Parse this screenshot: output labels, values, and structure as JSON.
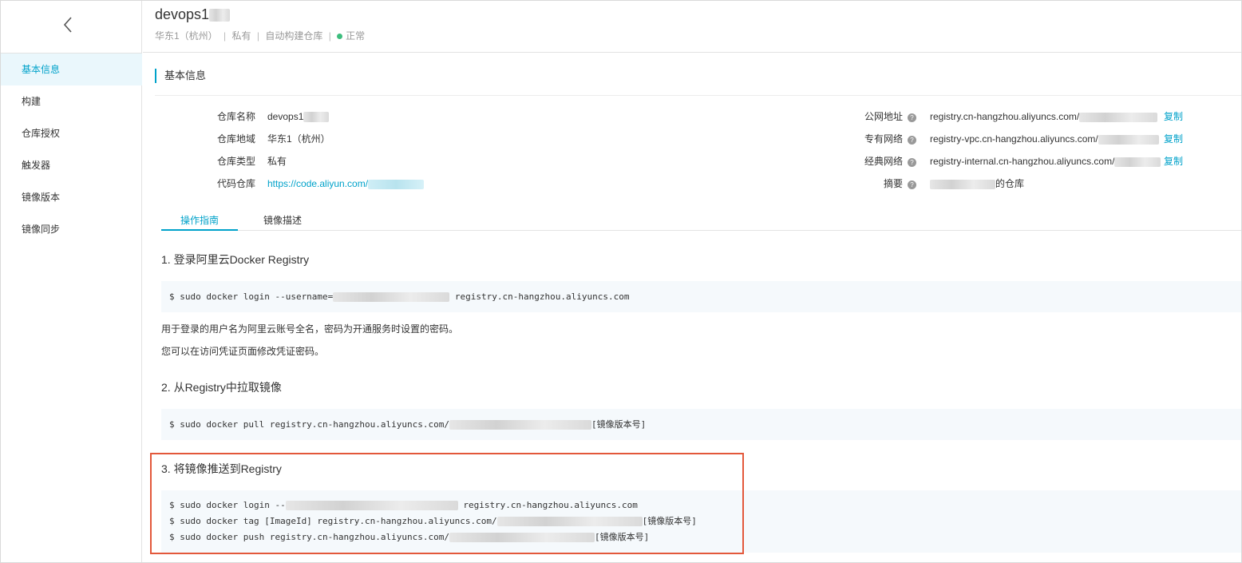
{
  "header": {
    "title": "devops1",
    "region": "华东1（杭州）",
    "type": "私有",
    "source": "自动构建仓库",
    "status": "正常",
    "status_color": "#3dbd7d"
  },
  "sidebar": {
    "items": [
      {
        "label": "基本信息"
      },
      {
        "label": "构建"
      },
      {
        "label": "仓库授权"
      },
      {
        "label": "触发器"
      },
      {
        "label": "镜像版本"
      },
      {
        "label": "镜像同步"
      }
    ]
  },
  "section": {
    "title": "基本信息"
  },
  "info": {
    "name_label": "仓库名称",
    "name_value": "devops1",
    "region_label": "仓库地域",
    "region_value": "华东1（杭州）",
    "type_label": "仓库类型",
    "type_value": "私有",
    "code_label": "代码仓库",
    "code_value": "https://code.aliyun.com/",
    "public_label": "公网地址",
    "public_value": "registry.cn-hangzhou.aliyuncs.com/",
    "vpc_label": "专有网络",
    "vpc_value": "registry-vpc.cn-hangzhou.aliyuncs.com/",
    "classic_label": "经典网络",
    "classic_value": "registry-internal.cn-hangzhou.aliyuncs.com/",
    "summary_label": "摘要",
    "summary_value": "的仓库",
    "copy_label": "复制",
    "help_glyph": "?"
  },
  "tabs": [
    {
      "label": "操作指南"
    },
    {
      "label": "镜像描述"
    }
  ],
  "steps": {
    "s1_title": "1. 登录阿里云Docker Registry",
    "s1_code_a": "$ sudo docker login --username=",
    "s1_code_b": " registry.cn-hangzhou.aliyuncs.com",
    "s1_note1": "用于登录的用户名为阿里云账号全名，密码为开通服务时设置的密码。",
    "s1_note2": "您可以在访问凭证页面修改凭证密码。",
    "s2_title": "2. 从Registry中拉取镜像",
    "s2_code_a": "$ sudo docker pull registry.cn-hangzhou.aliyuncs.com/",
    "s2_code_b": "[镜像版本号]",
    "s3_title": "3. 将镜像推送到Registry",
    "s3_code1_a": "$ sudo docker login --",
    "s3_code1_b": " registry.cn-hangzhou.aliyuncs.com",
    "s3_code2_a": "$ sudo docker tag [ImageId] registry.cn-hangzhou.aliyuncs.com/",
    "s3_code2_b": "[镜像版本号]",
    "s3_code3_a": "$ sudo docker push registry.cn-hangzhou.aliyuncs.com/",
    "s3_code3_b": "[镜像版本号]"
  },
  "colors": {
    "accent": "#00a2ca",
    "highlight": "#e3583b"
  }
}
